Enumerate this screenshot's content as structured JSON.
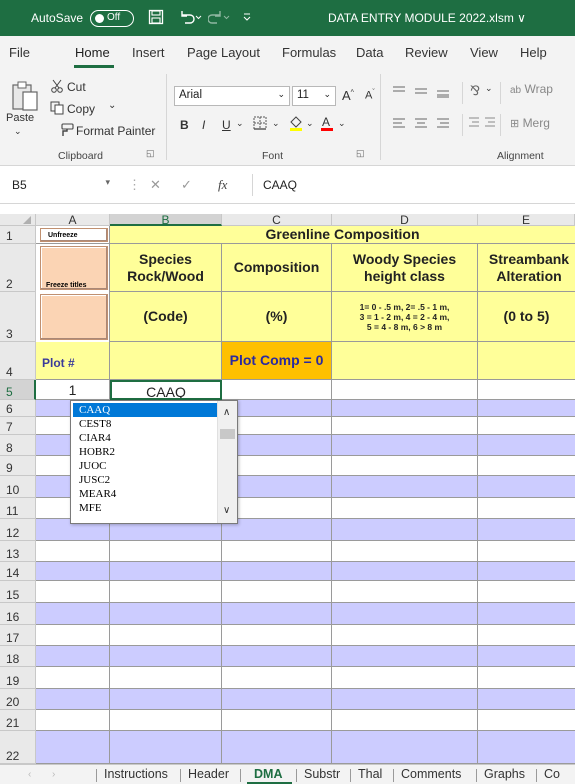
{
  "titlebar": {
    "autosave_label": "AutoSave",
    "autosave_state": "Off",
    "filename": "DATA ENTRY MODULE 2022.xlsm ∨"
  },
  "menu": {
    "file": "File",
    "home": "Home",
    "insert": "Insert",
    "page_layout": "Page Layout",
    "formulas": "Formulas",
    "data": "Data",
    "review": "Review",
    "view": "View",
    "help": "Help"
  },
  "ribbon": {
    "paste": "Paste",
    "cut": "Cut",
    "copy": "Copy",
    "format_painter": "Format Painter",
    "clipboard": "Clipboard",
    "font_name": "Arial",
    "font_size": "11",
    "font": "Font",
    "wrap": "Wrap",
    "merge": "Merg",
    "alignment": "Alignment"
  },
  "formula_bar": {
    "name_box": "B5",
    "fx": "fx",
    "content": "CAAQ"
  },
  "columns": [
    "A",
    "B",
    "C",
    "D",
    "E"
  ],
  "rows": [
    "1",
    "2",
    "3",
    "4",
    "5",
    "6",
    "7",
    "8",
    "9",
    "10",
    "11",
    "12",
    "13",
    "14",
    "15",
    "16",
    "17",
    "18",
    "19",
    "20",
    "21",
    "22"
  ],
  "sheet": {
    "unfreeze": "Unfreeze",
    "freeze_titles": "Freeze titles",
    "greenline_title": "Greenline Composition",
    "species_header": "Species Rock/Wood",
    "species_unit": "(Code)",
    "composition_header": "Composition",
    "composition_unit": "(%)",
    "woody_header": "Woody Species height class",
    "woody_codes": "1= 0 - .5 m,   2= .5 - 1 m,\n3 = 1 - 2 m,   4 = 2 - 4 m,\n5 = 4 - 8 m,   6 > 8 m",
    "stream_header": "Streambank Alteration",
    "stream_unit": "(0 to 5)",
    "plot_label": "Plot #",
    "plot_comp": "Plot Comp = 0",
    "a5": "1",
    "b5": "CAAQ"
  },
  "dropdown": {
    "options": [
      "CAAQ",
      "CEST8",
      "CIAR4",
      "HOBR2",
      "JUOC",
      "JUSC2",
      "MEAR4",
      "MFE"
    ],
    "selected": "CAAQ"
  },
  "tabs": {
    "instructions": "Instructions",
    "header": "Header",
    "dma": "DMA",
    "substr": "Substr",
    "thal": "Thal",
    "comments": "Comments",
    "graphs": "Graphs",
    "co": "Co"
  },
  "colors": {
    "excel_green": "#1e6e42",
    "header_yellow": "#ffff99",
    "row_lavender": "#ccccff",
    "plot_comp_orange": "#ffc000",
    "button_peach": "#fbd4b4",
    "selection_blue": "#0078d7"
  }
}
